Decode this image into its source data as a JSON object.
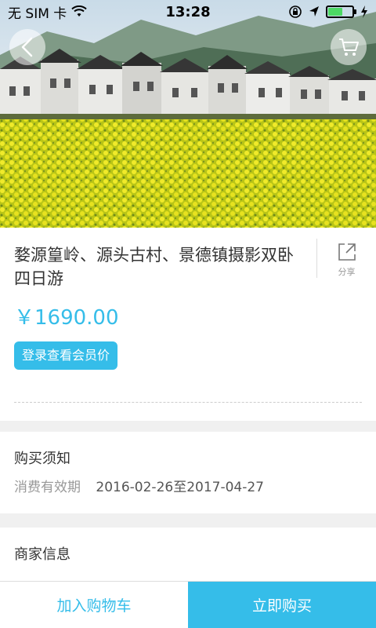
{
  "status_bar": {
    "carrier": "无 SIM 卡",
    "time": "13:28",
    "battery_level": 0.6,
    "icons": [
      "wifi-icon",
      "rotation-lock-icon",
      "location-icon",
      "battery-icon",
      "charging-icon"
    ]
  },
  "hero": {
    "back_icon": "chevron-left-icon",
    "cart_icon": "shopping-cart-icon"
  },
  "product": {
    "title": "婺源篁岭、源头古村、景德镇摄影双卧四日游",
    "share_label": "分享",
    "share_icon": "share-icon",
    "price": "￥1690.00",
    "member_price_button": "登录查看会员价"
  },
  "purchase_notes": {
    "title": "购买须知",
    "validity_label": "消费有效期",
    "validity_value": "2016-02-26至2017-04-27"
  },
  "merchant": {
    "title": "商家信息"
  },
  "bottom_bar": {
    "add_to_cart": "加入购物车",
    "buy_now": "立即购买"
  },
  "colors": {
    "accent": "#35bde9",
    "background": "#f0f0f0",
    "text": "#333333"
  }
}
